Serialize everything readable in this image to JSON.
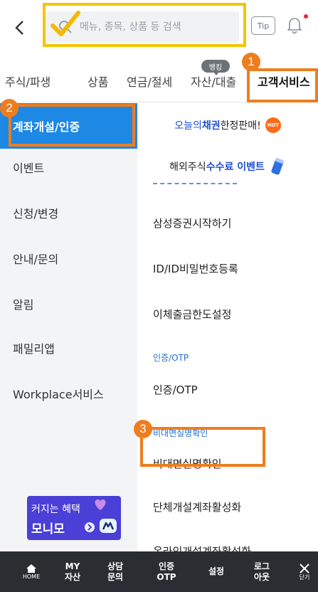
{
  "header": {
    "search_placeholder": "메뉴, 종목, 상품 등 검색",
    "tip_label": "Tip"
  },
  "tabs": [
    {
      "label": "주식/파생"
    },
    {
      "label": "상품"
    },
    {
      "label": "연금/절세"
    },
    {
      "label": "자산/대출"
    },
    {
      "label": "고객서비스"
    }
  ],
  "banking_badge": "뱅킹",
  "markers": [
    "1",
    "2",
    "3"
  ],
  "sidebar": {
    "items": [
      {
        "label": "계좌개설/인증"
      },
      {
        "label": "이벤트"
      },
      {
        "label": "신청/변경"
      },
      {
        "label": "안내/문의"
      },
      {
        "label": "알림"
      },
      {
        "label": "패밀리앱"
      },
      {
        "label": "Workplace서비스"
      }
    ],
    "promo_line1": "커지는 혜택",
    "promo_line2": "모니모"
  },
  "banners": {
    "first": {
      "prefix": "오늘의",
      "highlight": "채권",
      "suffix": " 한정판매!",
      "badge": "HOT"
    },
    "second": {
      "prefix": "해외주식 ",
      "highlight": "수수료 이벤트"
    }
  },
  "content": {
    "items": [
      {
        "label": "삼성증권시작하기"
      },
      {
        "label": "ID/ID비밀번호등록"
      },
      {
        "label": "이체출금한도설정"
      }
    ],
    "section_auth": "인증/OTP",
    "auth_item": "인증/OTP",
    "section_verify": "비대면실명확인",
    "verify_item": "비대면실명확인",
    "more_items": [
      {
        "label": "단체개설계좌활성화"
      },
      {
        "label": "온라인개설계좌활성화"
      }
    ]
  },
  "bottom_bar": {
    "items": [
      {
        "line1": "",
        "line2": "HOME"
      },
      {
        "line1": "MY",
        "line2": "자산"
      },
      {
        "line1": "상담",
        "line2": "문의"
      },
      {
        "line1": "인증",
        "line2": "OTP"
      },
      {
        "line1": "",
        "line2": "설정"
      },
      {
        "line1": "로그",
        "line2": "아웃"
      },
      {
        "line1": "",
        "line2": "닫기"
      }
    ]
  },
  "colors": {
    "accent_blue": "#1e88e5",
    "marker_orange": "#ee7d1f",
    "highlight_yellow": "#f5c400",
    "bottom_bar": "#2a2d31"
  }
}
